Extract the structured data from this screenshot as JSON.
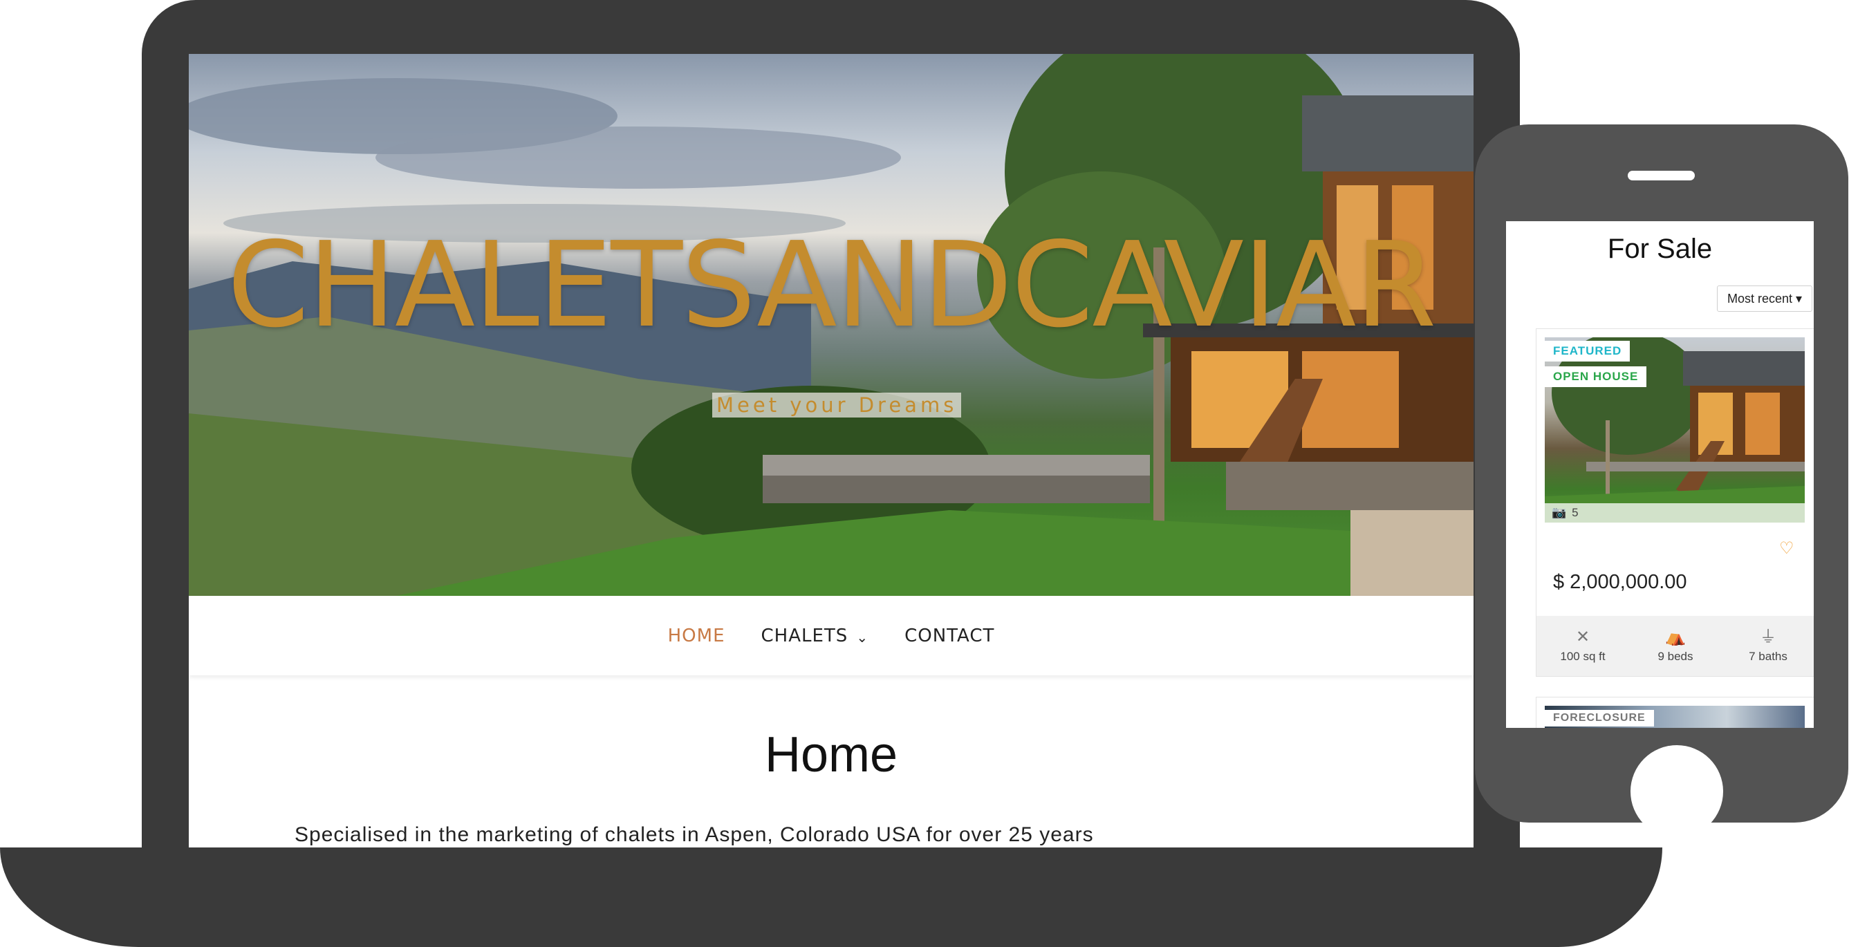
{
  "laptop_site": {
    "hero": {
      "title": "CHALETSANDCAVIAR",
      "tagline": "Meet your Dreams"
    },
    "nav": {
      "items": [
        {
          "label": "HOME",
          "active": true
        },
        {
          "label": "CHALETS",
          "has_dropdown": true
        },
        {
          "label": "CONTACT"
        }
      ],
      "dropdown_icon": "chevron-down-icon"
    },
    "page": {
      "title": "Home",
      "intro": "Specialised in the marketing of chalets in Aspen, Colorado USA for over 25 years"
    }
  },
  "phone_site": {
    "title": "For Sale",
    "sort": {
      "selected": "Most recent ▾"
    },
    "listings": [
      {
        "badges": [
          "FEATURED",
          "OPEN HOUSE"
        ],
        "photo_count": "5",
        "price": "$ 2,000,000.00",
        "stats": [
          {
            "icon": "area-icon",
            "label": "100 sq ft"
          },
          {
            "icon": "bed-icon",
            "label": "9 beds"
          },
          {
            "icon": "shower-icon",
            "label": "7 baths"
          }
        ]
      },
      {
        "badges": [
          "FORECLOSURE"
        ]
      }
    ]
  },
  "colors": {
    "device": "#3a3a3a",
    "phone_body": "#535353",
    "title_gold": "#c48c2e",
    "nav_active": "#c87a45",
    "badge_featured": "#1fb6c9",
    "badge_open_house": "#2aa64a",
    "favorite": "#f0a23a"
  }
}
